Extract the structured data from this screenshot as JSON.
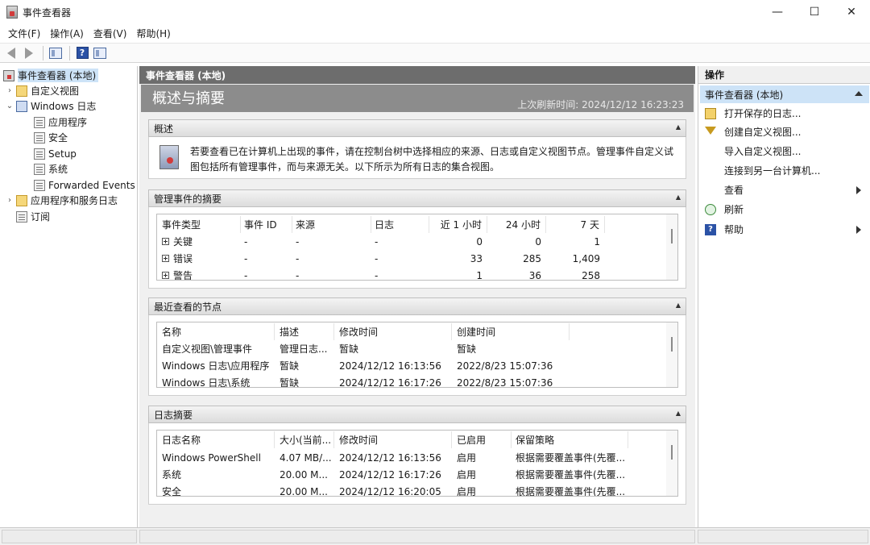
{
  "window": {
    "title": "事件查看器",
    "minimize": "—",
    "maximize": "☐",
    "close": "✕"
  },
  "menu": [
    "文件(F)",
    "操作(A)",
    "查看(V)",
    "帮助(H)"
  ],
  "tree": {
    "root": "事件查看器 (本地)",
    "custom_views": "自定义视图",
    "windows_logs": "Windows 日志",
    "logs": [
      "应用程序",
      "安全",
      "Setup",
      "系统",
      "Forwarded Events"
    ],
    "app_service_logs": "应用程序和服务日志",
    "subscriptions": "订阅"
  },
  "center": {
    "header": "事件查看器 (本地)",
    "banner_title": "概述与摘要",
    "banner_time": "上次刷新时间: 2024/12/12 16:23:23",
    "overview": {
      "title": "概述",
      "text": "若要查看已在计算机上出现的事件，请在控制台树中选择相应的来源、日志或自定义视图节点。管理事件自定义试图包括所有管理事件，而与来源无关。以下所示为所有日志的集合视图。"
    },
    "admin_summary": {
      "title": "管理事件的摘要",
      "headers": [
        "事件类型",
        "事件 ID",
        "来源",
        "日志",
        "近 1 小时",
        "24 小时",
        "7 天"
      ],
      "rows": [
        [
          "关键",
          "-",
          "-",
          "-",
          "0",
          "0",
          "1"
        ],
        [
          "错误",
          "-",
          "-",
          "-",
          "33",
          "285",
          "1,409"
        ],
        [
          "警告",
          "-",
          "-",
          "-",
          "1",
          "36",
          "258"
        ]
      ]
    },
    "recent_nodes": {
      "title": "最近查看的节点",
      "headers": [
        "名称",
        "描述",
        "修改时间",
        "创建时间"
      ],
      "rows": [
        [
          "自定义视图\\管理事件",
          "管理日志...",
          "暂缺",
          "暂缺"
        ],
        [
          "Windows 日志\\应用程序",
          "暂缺",
          "2024/12/12 16:13:56",
          "2022/8/23 15:07:36"
        ],
        [
          "Windows 日志\\系统",
          "暂缺",
          "2024/12/12 16:17:26",
          "2022/8/23 15:07:36"
        ]
      ]
    },
    "log_summary": {
      "title": "日志摘要",
      "headers": [
        "日志名称",
        "大小(当前...",
        "修改时间",
        "已启用",
        "保留策略"
      ],
      "rows": [
        [
          "Windows PowerShell",
          "4.07 MB/...",
          "2024/12/12 16:13:56",
          "启用",
          "根据需要覆盖事件(先覆..."
        ],
        [
          "系统",
          "20.00 M...",
          "2024/12/12 16:17:26",
          "启用",
          "根据需要覆盖事件(先覆..."
        ],
        [
          "安全",
          "20.00 M...",
          "2024/12/12 16:20:05",
          "启用",
          "根据需要覆盖事件(先覆..."
        ]
      ]
    }
  },
  "actions": {
    "title": "操作",
    "group": "事件查看器 (本地)",
    "items": [
      "打开保存的日志...",
      "创建自定义视图...",
      "导入自定义视图...",
      "连接到另一台计算机...",
      "查看",
      "刷新",
      "帮助"
    ]
  }
}
